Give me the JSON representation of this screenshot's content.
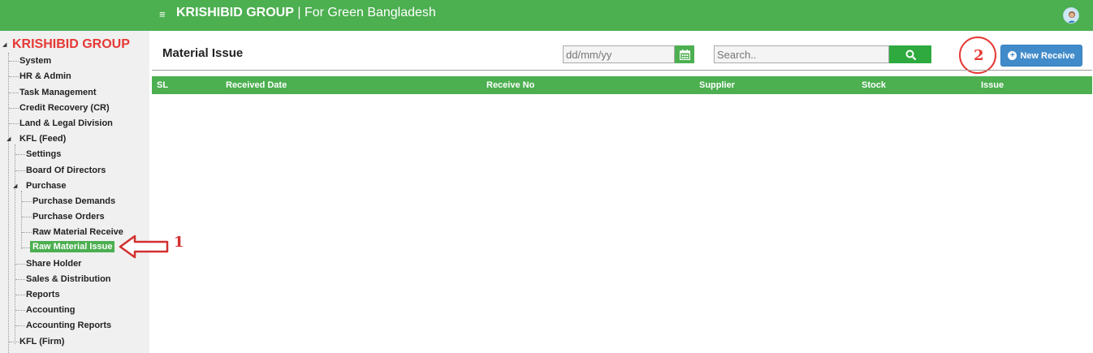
{
  "header": {
    "brand_bold": "KRISHIBID GROUP",
    "brand_rest": " | For Green Bangladesh",
    "menu_icon": "hamburger-icon",
    "avatar_icon": "user-avatar"
  },
  "sidebar": {
    "title": "KRISHIBID GROUP",
    "items": [
      {
        "label": "System"
      },
      {
        "label": "HR & Admin"
      },
      {
        "label": "Task Management"
      },
      {
        "label": "Credit Recovery (CR)"
      },
      {
        "label": "Land & Legal Division"
      },
      {
        "label": "KFL (Feed)"
      },
      {
        "label": "Settings"
      },
      {
        "label": "Board Of Directors"
      },
      {
        "label": "Purchase"
      },
      {
        "label": "Purchase Demands"
      },
      {
        "label": "Purchase Orders"
      },
      {
        "label": "Raw Material Receive"
      },
      {
        "label": "Raw Material Issue"
      },
      {
        "label": "Share Holder"
      },
      {
        "label": "Sales & Distribution"
      },
      {
        "label": "Reports"
      },
      {
        "label": "Accounting"
      },
      {
        "label": "Accounting Reports"
      },
      {
        "label": "KFL (Firm)"
      }
    ]
  },
  "annotations": {
    "step1": "1",
    "step2": "2",
    "arrow_color": "#d32f2f"
  },
  "main": {
    "title": "Material Issue",
    "date_placeholder": "dd/mm/yy",
    "search_placeholder": "Search..",
    "new_button_label": "New Receive",
    "table_headers": [
      "SL",
      "Received Date",
      "Receive No",
      "Supplier",
      "Stock",
      "Issue"
    ]
  },
  "colors": {
    "primary_green": "#4caf50",
    "brand_red": "#e53935",
    "button_blue": "#428bca"
  }
}
